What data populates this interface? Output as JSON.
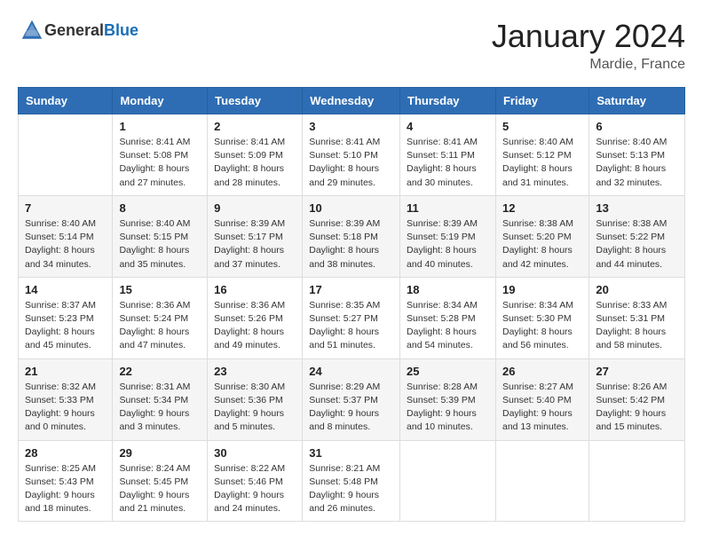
{
  "header": {
    "logo_general": "General",
    "logo_blue": "Blue",
    "month_title": "January 2024",
    "location": "Mardie, France"
  },
  "days_of_week": [
    "Sunday",
    "Monday",
    "Tuesday",
    "Wednesday",
    "Thursday",
    "Friday",
    "Saturday"
  ],
  "weeks": [
    [
      {
        "day": "",
        "sunrise": "",
        "sunset": "",
        "daylight": ""
      },
      {
        "day": "1",
        "sunrise": "Sunrise: 8:41 AM",
        "sunset": "Sunset: 5:08 PM",
        "daylight": "Daylight: 8 hours and 27 minutes."
      },
      {
        "day": "2",
        "sunrise": "Sunrise: 8:41 AM",
        "sunset": "Sunset: 5:09 PM",
        "daylight": "Daylight: 8 hours and 28 minutes."
      },
      {
        "day": "3",
        "sunrise": "Sunrise: 8:41 AM",
        "sunset": "Sunset: 5:10 PM",
        "daylight": "Daylight: 8 hours and 29 minutes."
      },
      {
        "day": "4",
        "sunrise": "Sunrise: 8:41 AM",
        "sunset": "Sunset: 5:11 PM",
        "daylight": "Daylight: 8 hours and 30 minutes."
      },
      {
        "day": "5",
        "sunrise": "Sunrise: 8:40 AM",
        "sunset": "Sunset: 5:12 PM",
        "daylight": "Daylight: 8 hours and 31 minutes."
      },
      {
        "day": "6",
        "sunrise": "Sunrise: 8:40 AM",
        "sunset": "Sunset: 5:13 PM",
        "daylight": "Daylight: 8 hours and 32 minutes."
      }
    ],
    [
      {
        "day": "7",
        "sunrise": "Sunrise: 8:40 AM",
        "sunset": "Sunset: 5:14 PM",
        "daylight": "Daylight: 8 hours and 34 minutes."
      },
      {
        "day": "8",
        "sunrise": "Sunrise: 8:40 AM",
        "sunset": "Sunset: 5:15 PM",
        "daylight": "Daylight: 8 hours and 35 minutes."
      },
      {
        "day": "9",
        "sunrise": "Sunrise: 8:39 AM",
        "sunset": "Sunset: 5:17 PM",
        "daylight": "Daylight: 8 hours and 37 minutes."
      },
      {
        "day": "10",
        "sunrise": "Sunrise: 8:39 AM",
        "sunset": "Sunset: 5:18 PM",
        "daylight": "Daylight: 8 hours and 38 minutes."
      },
      {
        "day": "11",
        "sunrise": "Sunrise: 8:39 AM",
        "sunset": "Sunset: 5:19 PM",
        "daylight": "Daylight: 8 hours and 40 minutes."
      },
      {
        "day": "12",
        "sunrise": "Sunrise: 8:38 AM",
        "sunset": "Sunset: 5:20 PM",
        "daylight": "Daylight: 8 hours and 42 minutes."
      },
      {
        "day": "13",
        "sunrise": "Sunrise: 8:38 AM",
        "sunset": "Sunset: 5:22 PM",
        "daylight": "Daylight: 8 hours and 44 minutes."
      }
    ],
    [
      {
        "day": "14",
        "sunrise": "Sunrise: 8:37 AM",
        "sunset": "Sunset: 5:23 PM",
        "daylight": "Daylight: 8 hours and 45 minutes."
      },
      {
        "day": "15",
        "sunrise": "Sunrise: 8:36 AM",
        "sunset": "Sunset: 5:24 PM",
        "daylight": "Daylight: 8 hours and 47 minutes."
      },
      {
        "day": "16",
        "sunrise": "Sunrise: 8:36 AM",
        "sunset": "Sunset: 5:26 PM",
        "daylight": "Daylight: 8 hours and 49 minutes."
      },
      {
        "day": "17",
        "sunrise": "Sunrise: 8:35 AM",
        "sunset": "Sunset: 5:27 PM",
        "daylight": "Daylight: 8 hours and 51 minutes."
      },
      {
        "day": "18",
        "sunrise": "Sunrise: 8:34 AM",
        "sunset": "Sunset: 5:28 PM",
        "daylight": "Daylight: 8 hours and 54 minutes."
      },
      {
        "day": "19",
        "sunrise": "Sunrise: 8:34 AM",
        "sunset": "Sunset: 5:30 PM",
        "daylight": "Daylight: 8 hours and 56 minutes."
      },
      {
        "day": "20",
        "sunrise": "Sunrise: 8:33 AM",
        "sunset": "Sunset: 5:31 PM",
        "daylight": "Daylight: 8 hours and 58 minutes."
      }
    ],
    [
      {
        "day": "21",
        "sunrise": "Sunrise: 8:32 AM",
        "sunset": "Sunset: 5:33 PM",
        "daylight": "Daylight: 9 hours and 0 minutes."
      },
      {
        "day": "22",
        "sunrise": "Sunrise: 8:31 AM",
        "sunset": "Sunset: 5:34 PM",
        "daylight": "Daylight: 9 hours and 3 minutes."
      },
      {
        "day": "23",
        "sunrise": "Sunrise: 8:30 AM",
        "sunset": "Sunset: 5:36 PM",
        "daylight": "Daylight: 9 hours and 5 minutes."
      },
      {
        "day": "24",
        "sunrise": "Sunrise: 8:29 AM",
        "sunset": "Sunset: 5:37 PM",
        "daylight": "Daylight: 9 hours and 8 minutes."
      },
      {
        "day": "25",
        "sunrise": "Sunrise: 8:28 AM",
        "sunset": "Sunset: 5:39 PM",
        "daylight": "Daylight: 9 hours and 10 minutes."
      },
      {
        "day": "26",
        "sunrise": "Sunrise: 8:27 AM",
        "sunset": "Sunset: 5:40 PM",
        "daylight": "Daylight: 9 hours and 13 minutes."
      },
      {
        "day": "27",
        "sunrise": "Sunrise: 8:26 AM",
        "sunset": "Sunset: 5:42 PM",
        "daylight": "Daylight: 9 hours and 15 minutes."
      }
    ],
    [
      {
        "day": "28",
        "sunrise": "Sunrise: 8:25 AM",
        "sunset": "Sunset: 5:43 PM",
        "daylight": "Daylight: 9 hours and 18 minutes."
      },
      {
        "day": "29",
        "sunrise": "Sunrise: 8:24 AM",
        "sunset": "Sunset: 5:45 PM",
        "daylight": "Daylight: 9 hours and 21 minutes."
      },
      {
        "day": "30",
        "sunrise": "Sunrise: 8:22 AM",
        "sunset": "Sunset: 5:46 PM",
        "daylight": "Daylight: 9 hours and 24 minutes."
      },
      {
        "day": "31",
        "sunrise": "Sunrise: 8:21 AM",
        "sunset": "Sunset: 5:48 PM",
        "daylight": "Daylight: 9 hours and 26 minutes."
      },
      {
        "day": "",
        "sunrise": "",
        "sunset": "",
        "daylight": ""
      },
      {
        "day": "",
        "sunrise": "",
        "sunset": "",
        "daylight": ""
      },
      {
        "day": "",
        "sunrise": "",
        "sunset": "",
        "daylight": ""
      }
    ]
  ]
}
